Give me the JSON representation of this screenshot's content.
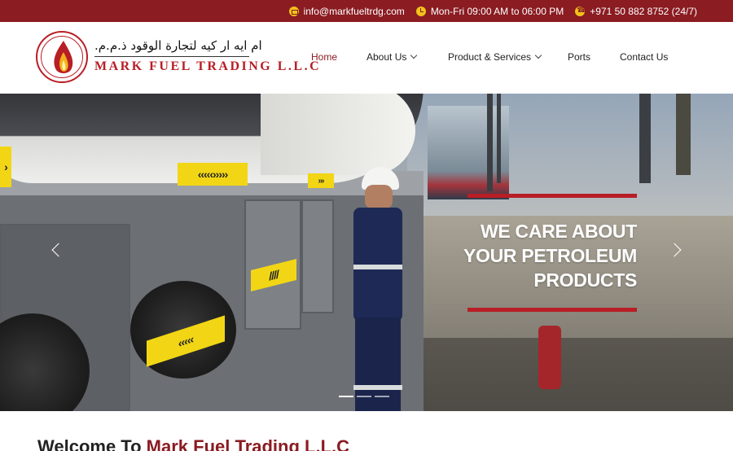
{
  "topbar": {
    "email": "info@markfueltrdg.com",
    "hours": "Mon-Fri 09:00 AM to 06:00 PM",
    "phone": "+971 50 882 8752 (24/7)"
  },
  "brand": {
    "arabic_name": "ام ايه ار كيه لتجارة الوقود ذ.م.م.",
    "english_name": "MARK FUEL TRADING L.L.C",
    "logo_ring_text": "MARK FUEL TRADING L.L.C"
  },
  "nav": {
    "items": [
      {
        "label": "Home",
        "active": true,
        "dropdown": false
      },
      {
        "label": "About Us",
        "active": false,
        "dropdown": true
      },
      {
        "label": "Product & Services",
        "active": false,
        "dropdown": true
      },
      {
        "label": "Ports",
        "active": false,
        "dropdown": false
      },
      {
        "label": "Contact Us",
        "active": false,
        "dropdown": false
      }
    ]
  },
  "hero": {
    "title_line1": "WE CARE ABOUT",
    "title_line2": "YOUR PETROLEUM",
    "title_line3": "PRODUCTS",
    "slides_total": 3,
    "active_slide": 1
  },
  "welcome": {
    "prefix": "Welcome To ",
    "company": "Mark Fuel Trading L.L.C"
  },
  "colors": {
    "brand_red": "#8a1c22",
    "accent_red": "#b81e25",
    "icon_yellow": "#f2c21a"
  },
  "icons": {
    "email": "mail-icon",
    "hours": "clock-icon",
    "phone": "phone-icon"
  }
}
